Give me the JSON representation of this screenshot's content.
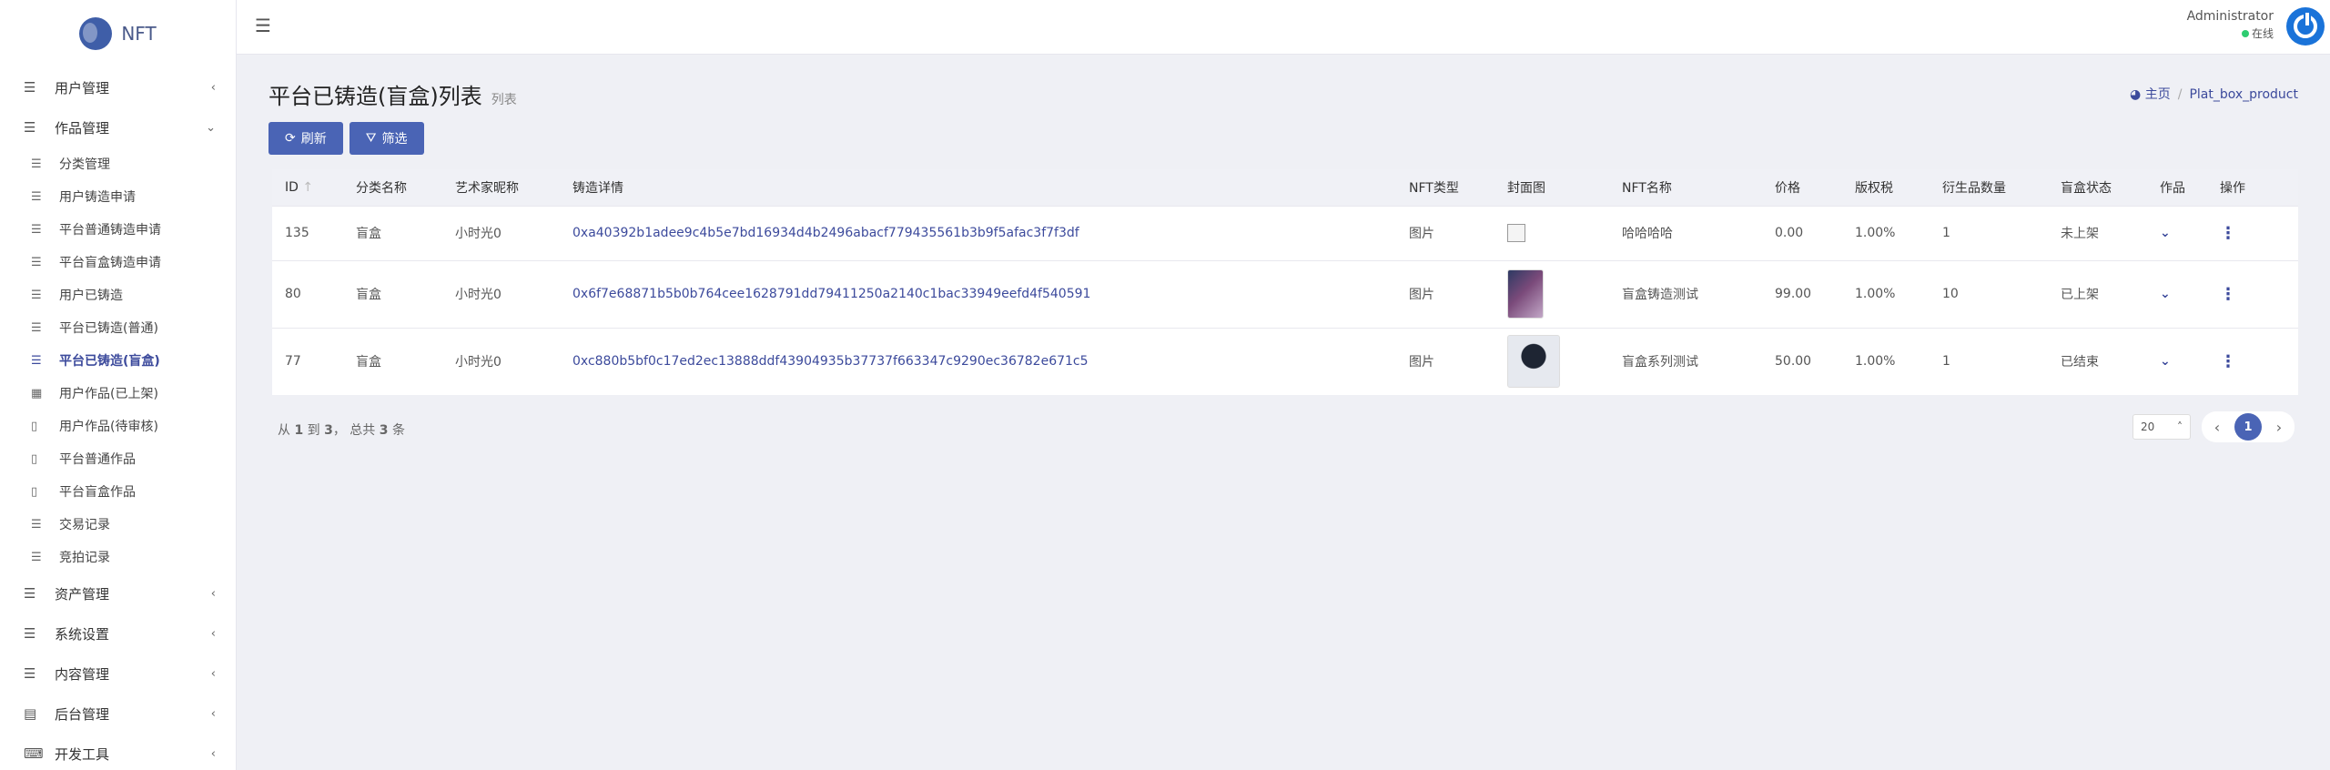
{
  "app": {
    "name": "NFT"
  },
  "sidebar": {
    "groups": [
      {
        "label": "用户管理",
        "icon": "list-icon"
      },
      {
        "label": "作品管理",
        "icon": "list-icon",
        "expanded": true
      },
      {
        "label": "资产管理",
        "icon": "list-icon"
      },
      {
        "label": "系统设置",
        "icon": "list-icon"
      },
      {
        "label": "内容管理",
        "icon": "list-icon"
      },
      {
        "label": "后台管理",
        "icon": "server-icon"
      },
      {
        "label": "开发工具",
        "icon": "keyboard-icon"
      }
    ],
    "works_items": [
      {
        "label": "分类管理"
      },
      {
        "label": "用户铸造申请"
      },
      {
        "label": "平台普通铸造申请"
      },
      {
        "label": "平台盲盒铸造申请"
      },
      {
        "label": "用户已铸造"
      },
      {
        "label": "平台已铸造(普通)"
      },
      {
        "label": "平台已铸造(盲盒)",
        "active": true
      },
      {
        "label": "用户作品(已上架)"
      },
      {
        "label": "用户作品(待审核)"
      },
      {
        "label": "平台普通作品"
      },
      {
        "label": "平台盲盒作品"
      },
      {
        "label": "交易记录"
      },
      {
        "label": "竞拍记录"
      }
    ]
  },
  "header": {
    "user_name": "Administrator",
    "user_status": "在线"
  },
  "page": {
    "title": "平台已铸造(盲盒)列表",
    "subtitle": "列表",
    "breadcrumb": [
      "主页",
      "Plat_box_product"
    ],
    "refresh_label": "刷新",
    "filter_label": "筛选"
  },
  "table": {
    "columns": [
      "ID",
      "分类名称",
      "艺术家昵称",
      "铸造详情",
      "NFT类型",
      "封面图",
      "NFT名称",
      "价格",
      "版权税",
      "衍生品数量",
      "盲盒状态",
      "作品",
      "操作"
    ],
    "rows": [
      {
        "id": "135",
        "category": "盲盒",
        "artist": "小时光0",
        "detail": "0xa40392b1adee9c4b5e7bd16934d4b2496abacf779435561b3b9f5afac3f7f3df",
        "type": "图片",
        "name": "哈哈哈哈",
        "price": "0.00",
        "tax": "1.00%",
        "derivatives": "1",
        "status": "未上架"
      },
      {
        "id": "80",
        "category": "盲盒",
        "artist": "小时光0",
        "detail": "0x6f7e68871b5b0b764cee1628791dd79411250a2140c1bac33949eefd4f540591",
        "type": "图片",
        "name": "盲盒铸造测试",
        "price": "99.00",
        "tax": "1.00%",
        "derivatives": "10",
        "status": "已上架"
      },
      {
        "id": "77",
        "category": "盲盒",
        "artist": "小时光0",
        "detail": "0xc880b5bf0c17ed2ec13888ddf43904935b37737f663347c9290ec36782e671c5",
        "type": "图片",
        "name": "盲盒系列测试",
        "price": "50.00",
        "tax": "1.00%",
        "derivatives": "1",
        "status": "已结束"
      }
    ]
  },
  "footer": {
    "info_prefix": "从",
    "from": "1",
    "to_word": "到",
    "to": "3",
    "total_word": "， 总共",
    "total": "3",
    "unit": "条",
    "page_size": "20",
    "current_page": "1"
  }
}
